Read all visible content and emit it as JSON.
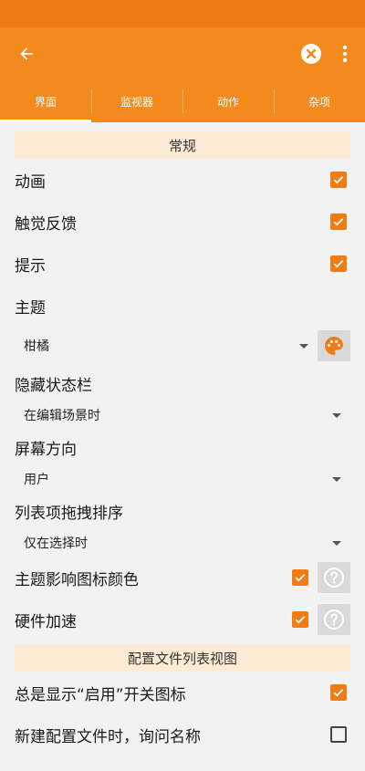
{
  "tabs": [
    {
      "label": "界面"
    },
    {
      "label": "监视器"
    },
    {
      "label": "动作"
    },
    {
      "label": "杂项"
    }
  ],
  "sections": {
    "general": "常规",
    "profile_list": "配置文件列表视图"
  },
  "settings": {
    "animation": {
      "label": "动画",
      "checked": true
    },
    "haptic": {
      "label": "触觉反馈",
      "checked": true
    },
    "hints": {
      "label": "提示",
      "checked": true
    },
    "theme": {
      "label": "主题",
      "value": "柑橘"
    },
    "hide_statusbar": {
      "label": "隐藏状态栏",
      "value": "在编辑场景时"
    },
    "orientation": {
      "label": "屏幕方向",
      "value": "用户"
    },
    "drag_sort": {
      "label": "列表项拖拽排序",
      "value": "仅在选择时"
    },
    "theme_icon_color": {
      "label": "主题影响图标颜色",
      "checked": true
    },
    "hw_accel": {
      "label": "硬件加速",
      "checked": true
    },
    "always_show_enable": {
      "label": "总是显示“启用”开关图标",
      "checked": true
    },
    "ask_name": {
      "label": "新建配置文件时，询问名称",
      "checked": false
    }
  },
  "icons": {
    "back": "arrow-left-icon",
    "clear": "close-circle-icon",
    "more": "more-vert-icon",
    "palette": "palette-icon",
    "help": "help-icon",
    "check": "check-icon"
  },
  "colors": {
    "accent": "#f48a1e",
    "statusbar": "#ec7a14",
    "checkbox": "#f07c15",
    "section_bg": "#fdebd6"
  }
}
